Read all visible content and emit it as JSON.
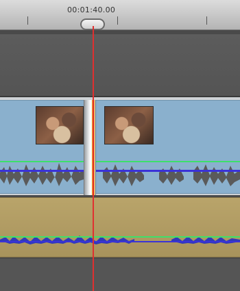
{
  "timeline": {
    "timecode": "00:01:40.00",
    "clips": [
      {
        "id": "clip-1"
      },
      {
        "id": "clip-2"
      }
    ]
  },
  "colors": {
    "playhead": "#e03030",
    "video_track": "#8ab0cd",
    "music_track": "#b9a46a",
    "volume_line": "#3de06a",
    "pan_line": "#3a32d8",
    "transition": "#f5a623"
  },
  "icons": {
    "playhead_handle": "playhead-handle-icon"
  }
}
